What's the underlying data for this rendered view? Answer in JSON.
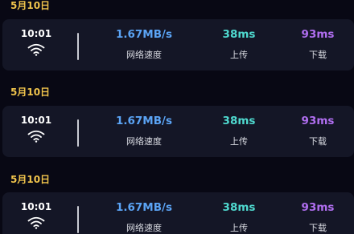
{
  "records": [
    {
      "date": "5月10日",
      "time": "10:01",
      "network_icon": "wifi-icon",
      "speed": {
        "value": "1.67MB/s",
        "label": "网络速度"
      },
      "upload": {
        "value": "38ms",
        "label": "上传"
      },
      "download": {
        "value": "93ms",
        "label": "下载"
      }
    },
    {
      "date": "5月10日",
      "time": "10:01",
      "network_icon": "wifi-icon",
      "speed": {
        "value": "1.67MB/s",
        "label": "网络速度"
      },
      "upload": {
        "value": "38ms",
        "label": "上传"
      },
      "download": {
        "value": "93ms",
        "label": "下载"
      }
    },
    {
      "date": "5月10日",
      "time": "10:01",
      "network_icon": "wifi-icon",
      "speed": {
        "value": "1.67MB/s",
        "label": "网络速度"
      },
      "upload": {
        "value": "38ms",
        "label": "上传"
      },
      "download": {
        "value": "93ms",
        "label": "下载"
      }
    }
  ],
  "colors": {
    "background": "#080814",
    "card": "#141626",
    "date": "#f0c44c",
    "speed": "#5ba4f5",
    "upload": "#4fd9cf",
    "download": "#b06ef0"
  }
}
